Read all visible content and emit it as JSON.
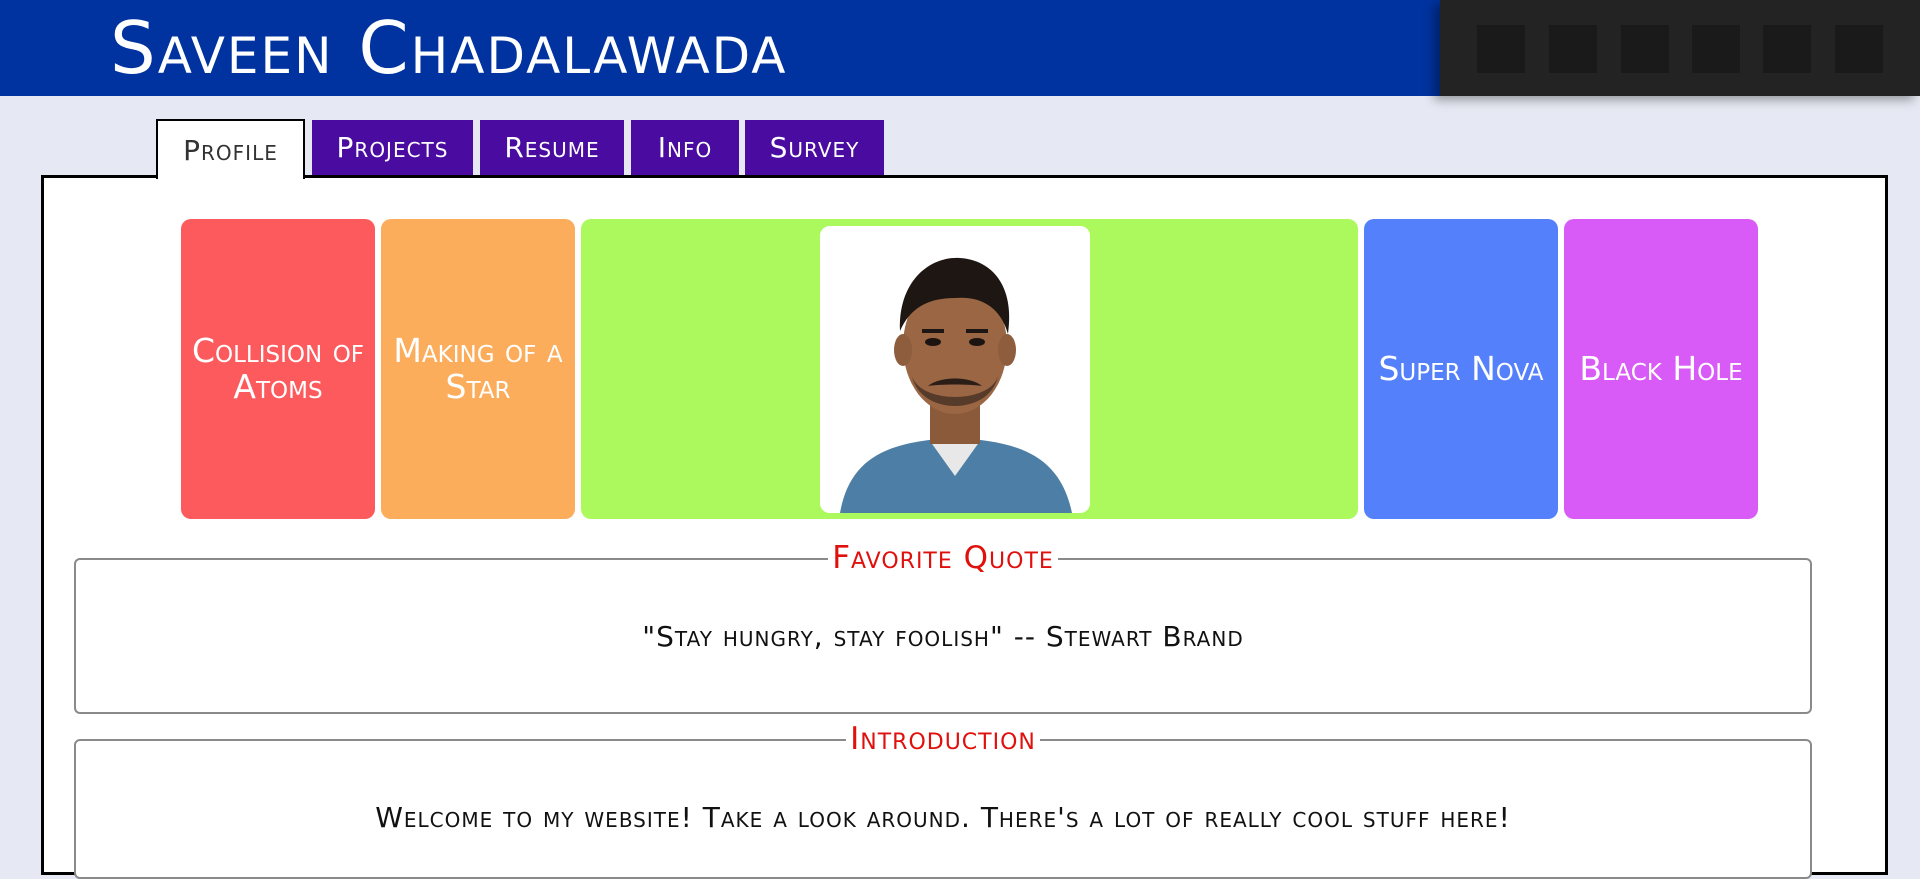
{
  "header": {
    "title": "Saveen Chadalawada",
    "background": "#0033a0"
  },
  "tabs": [
    {
      "label": "Profile",
      "active": true
    },
    {
      "label": "Projects",
      "active": false
    },
    {
      "label": "Resume",
      "active": false
    },
    {
      "label": "Info",
      "active": false
    },
    {
      "label": "Survey",
      "active": false
    }
  ],
  "cards": [
    {
      "label": "Collision of Atoms",
      "color": "#fc5a5c"
    },
    {
      "label": "Making of a Star",
      "color": "#fbad5b"
    },
    {
      "label": "",
      "color": "#abf95d"
    },
    {
      "label": "Super Nova",
      "color": "#5580fb"
    },
    {
      "label": "Black Hole",
      "color": "#d95bf7"
    }
  ],
  "quote": {
    "legend": "Favorite Quote",
    "text": "\"Stay hungry, stay foolish\" -- Stewart Brand"
  },
  "intro": {
    "legend": "Introduction",
    "text": "Welcome to my website! Take a look around. There's a lot of really cool stuff here!"
  },
  "colors": {
    "tab": "#4a0ca0",
    "legend": "#e0100d",
    "page_bg": "#e6e9f3"
  }
}
